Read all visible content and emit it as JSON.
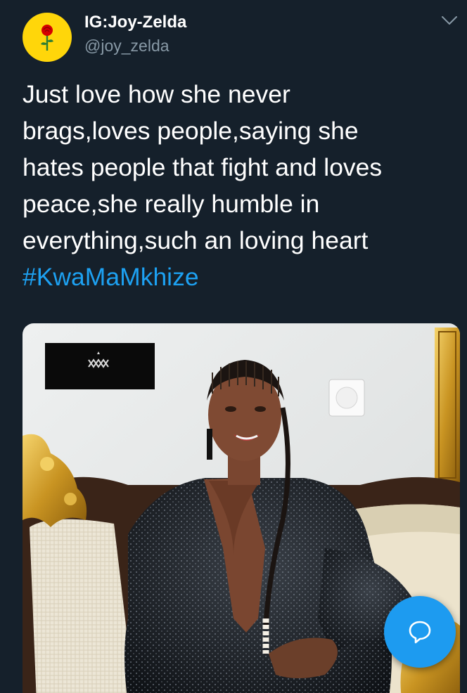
{
  "tweet": {
    "display_name": "IG:Joy-Zelda",
    "handle": "@joy_zelda",
    "text_lines": [
      "Just love how she never",
      "brags,loves people,saying she",
      "hates people that fight and loves",
      "peace,she really humble in",
      "everything,such an loving heart"
    ],
    "hashtag": "#KwaMaMkhize"
  },
  "media": {
    "watermark_text": "KWA MAMKHIZE"
  },
  "icons": {
    "avatar": "rose-icon",
    "menu": "chevron-down-icon",
    "compose": "chat-bubble-icon"
  },
  "colors": {
    "background": "#15202b",
    "text_primary": "#ffffff",
    "text_secondary": "#8899a6",
    "accent": "#1da1f2",
    "avatar_bg": "#ffd60a"
  }
}
